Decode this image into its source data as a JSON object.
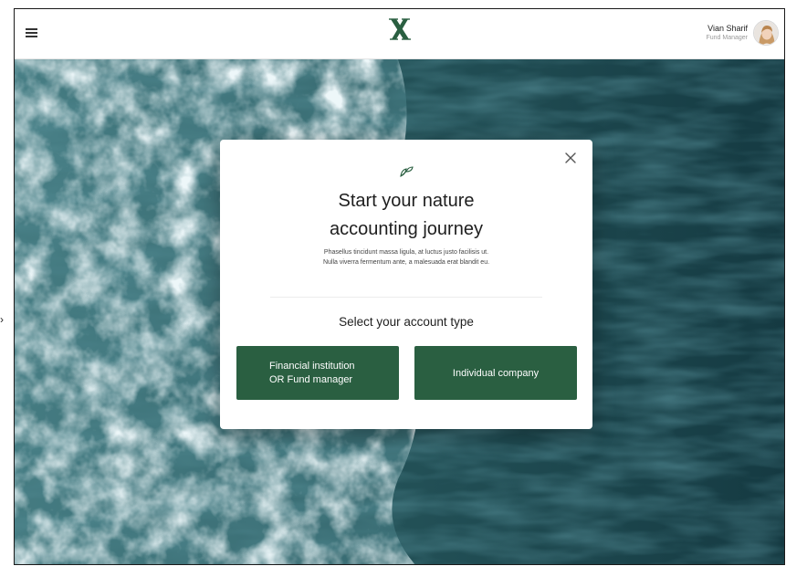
{
  "header": {
    "menu_icon": "hamburger-menu-icon",
    "logo_icon": "x-logo-icon",
    "logo_color": "#2a5f41",
    "user": {
      "name": "Vian Sharif",
      "role": "Fund Manager"
    }
  },
  "modal": {
    "close_icon": "close-icon",
    "title_lines": [
      "Start your nature",
      "accounting journey"
    ],
    "description_lines": [
      "Phasellus tincidunt massa ligula, at luctus justo facilisis ut.",
      "Nulla viverra fermentum ante, a malesuada erat blandit eu."
    ],
    "select_label": "Select your account type",
    "buttons": {
      "financial_institution_lines": [
        "Financial institution",
        "OR Fund manager"
      ],
      "individual_company": "Individual company"
    }
  },
  "colors": {
    "button_bg": "#2a5f41",
    "ocean_dark": "#163a40",
    "foam": "#e8f1f2"
  }
}
